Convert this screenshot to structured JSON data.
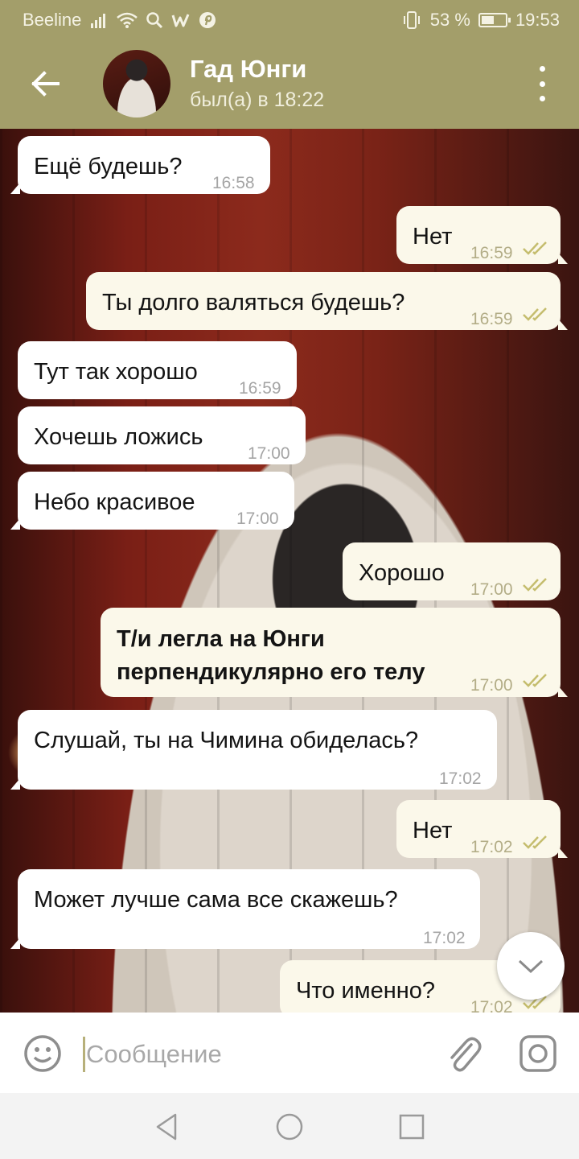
{
  "status_bar": {
    "carrier": "Beeline",
    "battery_percent": "53 %",
    "battery_level": 0.53,
    "time": "19:53",
    "icons": [
      "signal-icon",
      "wifi-icon",
      "search-icon",
      "w-app-icon",
      "pinterest-icon",
      "vibrate-icon",
      "battery-icon"
    ]
  },
  "header": {
    "chat_name": "Гад Юнги",
    "status": "был(а) в 18:22",
    "icons": [
      "back-arrow-icon",
      "avatar",
      "more-vert-icon"
    ],
    "color": "#a39e6a"
  },
  "messages": [
    {
      "direction": "in",
      "text": "Ещё будешь?",
      "time": "16:58"
    },
    {
      "direction": "out",
      "text": "Нет",
      "time": "16:59",
      "read": true
    },
    {
      "direction": "out",
      "text": "Ты долго валяться будешь?",
      "time": "16:59",
      "read": true
    },
    {
      "direction": "in",
      "text": "Тут так хорошо",
      "time": "16:59"
    },
    {
      "direction": "in",
      "text": "Хочешь ложись",
      "time": "17:00"
    },
    {
      "direction": "in",
      "text": "Небо красивое",
      "time": "17:00"
    },
    {
      "direction": "out",
      "text": "Хорошо",
      "time": "17:00",
      "read": true
    },
    {
      "direction": "out",
      "text_lines": [
        "Т/и легла на Юнги",
        "перпендикулярно его телу"
      ],
      "time": "17:00",
      "read": true,
      "bold": true
    },
    {
      "direction": "in",
      "text": "Слушай, ты на Чимина обиделась?",
      "time": "17:02"
    },
    {
      "direction": "out",
      "text": "Нет",
      "time": "17:02",
      "read": true
    },
    {
      "direction": "in",
      "text": "Может лучше сама все скажешь?",
      "time": "17:02"
    },
    {
      "direction": "out",
      "text": "Что именно?",
      "time": "17:02",
      "read": true
    }
  ],
  "input": {
    "placeholder": "Сообщение",
    "icons": [
      "emoji-icon",
      "attach-icon",
      "camera-icon"
    ]
  },
  "scroll_down": {
    "icon": "chevron-down-icon"
  },
  "nav_bar": {
    "icons": [
      "nav-back-icon",
      "nav-home-icon",
      "nav-recents-icon"
    ]
  },
  "colors": {
    "accent": "#a39e6a",
    "incoming_bubble": "#ffffff",
    "outgoing_bubble": "#fbf8ea",
    "read_checks": "#c5bd6e"
  }
}
